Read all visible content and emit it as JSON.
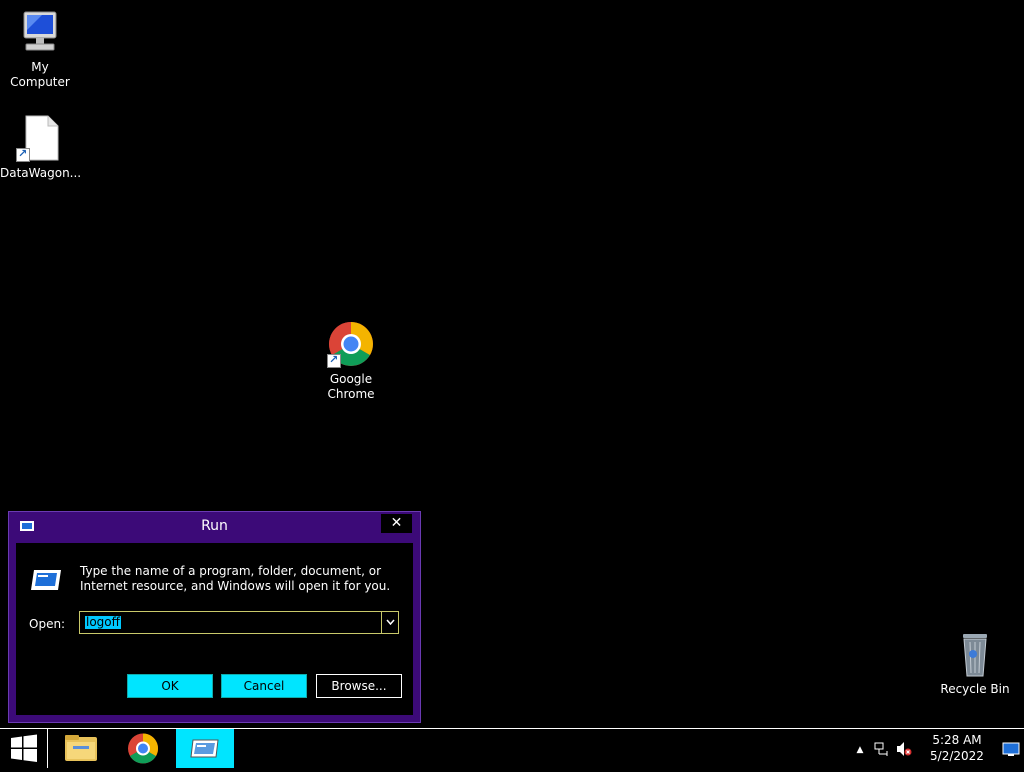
{
  "desktop_icons": {
    "my_computer": "My Computer",
    "datawagon": "DataWagon...",
    "chrome_line1": "Google",
    "chrome_line2": "Chrome",
    "recycle_bin": "Recycle Bin"
  },
  "run_dialog": {
    "title": "Run",
    "close_glyph": "✕",
    "description": "Type the name of a program, folder, document, or Internet resource, and Windows will open it for you.",
    "open_label": "Open:",
    "open_value": "logoff",
    "ok_label": "OK",
    "cancel_label": "Cancel",
    "browse_label": "Browse..."
  },
  "taskbar": {
    "clock_time": "5:28 AM",
    "clock_date": "5/2/2022",
    "tray_overflow_glyph": "▲"
  },
  "colors": {
    "dialog_frame": "#3c0a78",
    "highlight": "#00e5ff",
    "selection": "#00c8ff"
  },
  "icons": [
    "my-computer-icon",
    "file-shortcut-icon",
    "chrome-icon",
    "recycle-bin-icon",
    "run-icon",
    "windows-logo-icon",
    "file-explorer-icon",
    "network-icon",
    "volume-muted-icon",
    "show-desktop-icon"
  ]
}
